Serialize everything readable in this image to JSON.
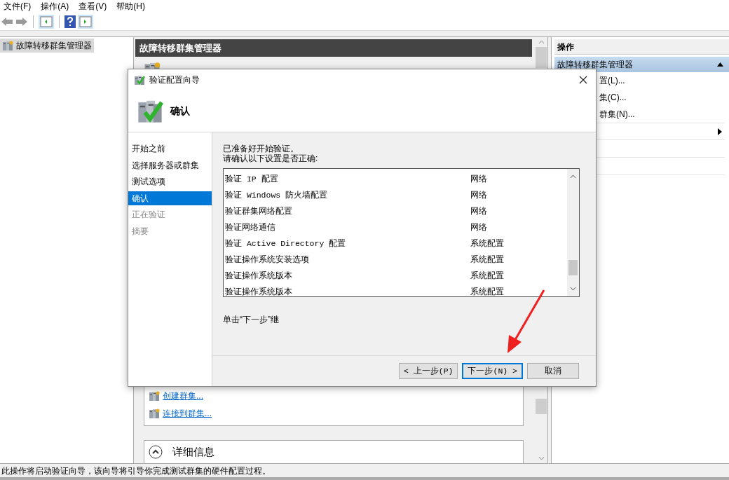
{
  "menu": [
    {
      "label": "文件(F)"
    },
    {
      "label": "操作(A)"
    },
    {
      "label": "查看(V)"
    },
    {
      "label": "帮助(H)"
    }
  ],
  "tree": [
    {
      "label": "故障转移群集管理器",
      "selected": true
    }
  ],
  "center": {
    "title": "故障转移群集管理器",
    "links": [
      "创建群集...",
      "连接到群集..."
    ],
    "details_title": "详细信息"
  },
  "actions": {
    "title": "操作",
    "group": {
      "label": "故障转移群集管理器",
      "expanded": true
    },
    "items": [
      "置(L)...",
      "集(C)...",
      "群集(N)..."
    ]
  },
  "dialog": {
    "title": "验证配置向导",
    "heading": "确认",
    "steps": [
      {
        "label": "开始之前",
        "selected": false,
        "disabled": false
      },
      {
        "label": "选择服务器或群集",
        "selected": false,
        "disabled": false
      },
      {
        "label": "测试选项",
        "selected": false,
        "disabled": false
      },
      {
        "label": "确认",
        "selected": true,
        "disabled": false
      },
      {
        "label": "正在验证",
        "selected": false,
        "disabled": true
      },
      {
        "label": "摘要",
        "selected": false,
        "disabled": true
      }
    ],
    "intro": [
      "已准备好开始验证。",
      "请确认以下设置是否正确:"
    ],
    "tests": [
      {
        "name": "验证 IP 配置",
        "category": "网络"
      },
      {
        "name": "验证 Windows 防火墙配置",
        "category": "网络"
      },
      {
        "name": "验证群集网络配置",
        "category": "网络"
      },
      {
        "name": "验证网络通信",
        "category": "网络"
      },
      {
        "name": "验证 Active Directory 配置",
        "category": "系统配置"
      },
      {
        "name": "验证操作系统安装选项",
        "category": "系统配置"
      },
      {
        "name": "验证操作系统版本",
        "category": "系统配置"
      },
      {
        "name": "验证操作系统版本",
        "category": "系统配置"
      }
    ],
    "hint": "单击“下一步”继",
    "buttons": [
      {
        "label": "< 上一步(P)",
        "kind": "normal"
      },
      {
        "label": "下一步(N) >",
        "kind": "default"
      },
      {
        "label": "取消",
        "kind": "normal"
      }
    ]
  },
  "status_bar": "此操作将启动验证向导，该向导将引导你完成测试群集的硬件配置过程。"
}
